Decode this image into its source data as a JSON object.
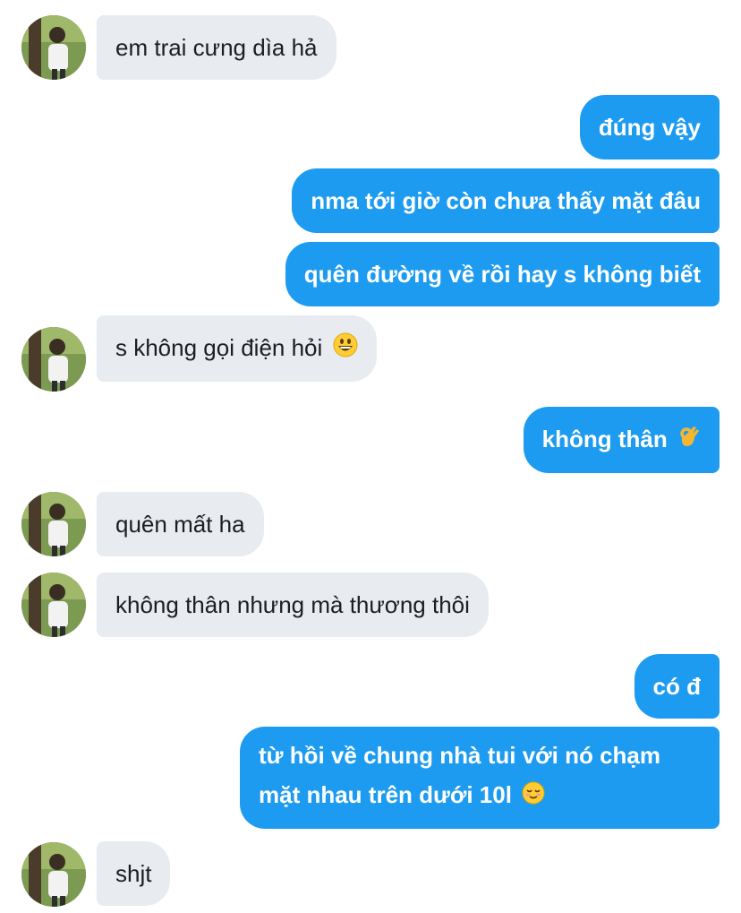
{
  "conversation": {
    "messages": [
      {
        "sender": "them",
        "text": "em trai cưng dìa hả",
        "avatar": true
      },
      {
        "sender": "me",
        "text": "đúng vậy"
      },
      {
        "sender": "me",
        "text": "nma tới giờ còn chưa thấy mặt đâu"
      },
      {
        "sender": "me",
        "text": "quên đường về rồi hay s không biết"
      },
      {
        "sender": "them",
        "text": "s không gọi điện hỏi",
        "emoji": "grinning-face",
        "avatar": true
      },
      {
        "sender": "me",
        "text": "không thân",
        "emoji": "ok-hand"
      },
      {
        "sender": "them",
        "text": "quên mất ha",
        "avatar": true
      },
      {
        "sender": "them",
        "text": "không thân nhưng mà thương thôi",
        "avatar": true
      },
      {
        "sender": "me",
        "text": "có đ"
      },
      {
        "sender": "me",
        "text": "từ hồi về chung nhà tui với nó chạm mặt nhau trên dưới 10l",
        "emoji": "relieved-face"
      },
      {
        "sender": "them",
        "text": "shjt",
        "avatar": true
      }
    ]
  },
  "colors": {
    "outgoing_bubble": "#1d9bf0",
    "incoming_bubble": "#e8ebef",
    "outgoing_text": "#ffffff",
    "incoming_text": "#1b1e22"
  }
}
